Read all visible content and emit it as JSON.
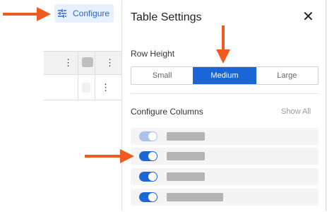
{
  "toolbar": {
    "configure_label": "Configure"
  },
  "panel": {
    "title": "Table Settings",
    "close_glyph": "✕",
    "row_height": {
      "label": "Row Height",
      "options": [
        "Small",
        "Medium",
        "Large"
      ],
      "selected": "Medium"
    },
    "columns": {
      "label": "Configure Columns",
      "show_all": "Show All",
      "items": [
        {
          "enabled": false
        },
        {
          "enabled": true
        },
        {
          "enabled": true
        },
        {
          "enabled": true
        }
      ]
    }
  },
  "grid": {
    "header_menu": "⋮",
    "row_menu": "⋮"
  },
  "colors": {
    "accent": "#1a66d6",
    "annotation": "#f05a1e"
  }
}
